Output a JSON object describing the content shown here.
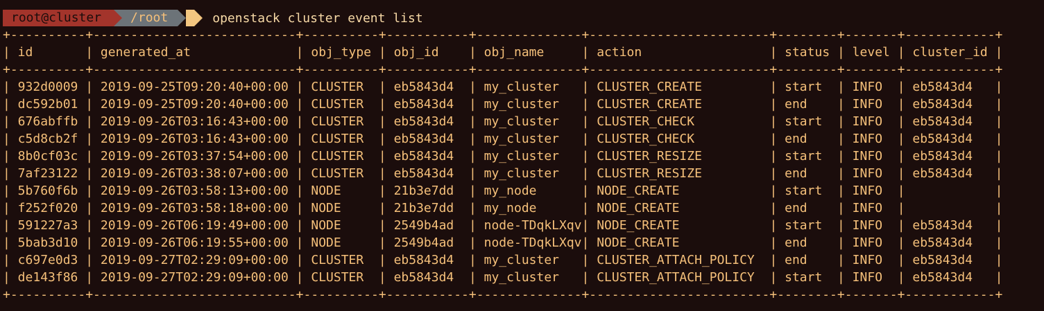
{
  "prompt": {
    "user_host": "root@cluster",
    "path": "/root",
    "command": "openstack cluster event list"
  },
  "table": {
    "columns": [
      "id",
      "generated_at",
      "obj_type",
      "obj_id",
      "obj_name",
      "action",
      "status",
      "level",
      "cluster_id"
    ],
    "widths": [
      10,
      27,
      10,
      11,
      14,
      24,
      8,
      7,
      12
    ],
    "rows": [
      [
        "932d0009",
        "2019-09-25T09:20:40+00:00",
        "CLUSTER",
        "eb5843d4",
        "my_cluster",
        "CLUSTER_CREATE",
        "start",
        "INFO",
        "eb5843d4"
      ],
      [
        "dc592b01",
        "2019-09-25T09:20:40+00:00",
        "CLUSTER",
        "eb5843d4",
        "my_cluster",
        "CLUSTER_CREATE",
        "end",
        "INFO",
        "eb5843d4"
      ],
      [
        "676abffb",
        "2019-09-26T03:16:43+00:00",
        "CLUSTER",
        "eb5843d4",
        "my_cluster",
        "CLUSTER_CHECK",
        "start",
        "INFO",
        "eb5843d4"
      ],
      [
        "c5d8cb2f",
        "2019-09-26T03:16:43+00:00",
        "CLUSTER",
        "eb5843d4",
        "my_cluster",
        "CLUSTER_CHECK",
        "end",
        "INFO",
        "eb5843d4"
      ],
      [
        "8b0cf03c",
        "2019-09-26T03:37:54+00:00",
        "CLUSTER",
        "eb5843d4",
        "my_cluster",
        "CLUSTER_RESIZE",
        "start",
        "INFO",
        "eb5843d4"
      ],
      [
        "7af23122",
        "2019-09-26T03:38:07+00:00",
        "CLUSTER",
        "eb5843d4",
        "my_cluster",
        "CLUSTER_RESIZE",
        "end",
        "INFO",
        "eb5843d4"
      ],
      [
        "5b760f6b",
        "2019-09-26T03:58:13+00:00",
        "NODE",
        "21b3e7dd",
        "my_node",
        "NODE_CREATE",
        "start",
        "INFO",
        ""
      ],
      [
        "f252f020",
        "2019-09-26T03:58:18+00:00",
        "NODE",
        "21b3e7dd",
        "my_node",
        "NODE_CREATE",
        "end",
        "INFO",
        ""
      ],
      [
        "591227a3",
        "2019-09-26T06:19:49+00:00",
        "NODE",
        "2549b4ad",
        "node-TDqkLXqv",
        "NODE_CREATE",
        "start",
        "INFO",
        "eb5843d4"
      ],
      [
        "5bab3d10",
        "2019-09-26T06:19:55+00:00",
        "NODE",
        "2549b4ad",
        "node-TDqkLXqv",
        "NODE_CREATE",
        "end",
        "INFO",
        "eb5843d4"
      ],
      [
        "c697e0d3",
        "2019-09-27T02:29:09+00:00",
        "CLUSTER",
        "eb5843d4",
        "my_cluster",
        "CLUSTER_ATTACH_POLICY",
        "end",
        "INFO",
        "eb5843d4"
      ],
      [
        "de143f86",
        "2019-09-27T02:29:09+00:00",
        "CLUSTER",
        "eb5843d4",
        "my_cluster",
        "CLUSTER_ATTACH_POLICY",
        "start",
        "INFO",
        "eb5843d4"
      ]
    ]
  }
}
